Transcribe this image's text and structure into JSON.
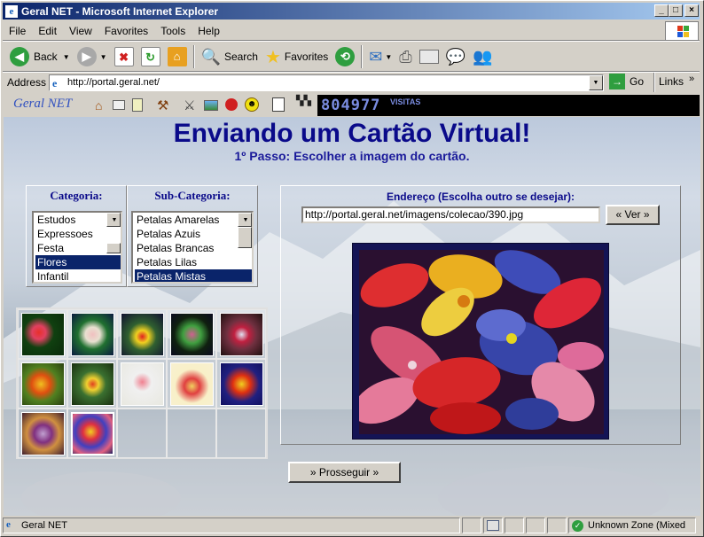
{
  "window": {
    "title": "Geral NET - Microsoft Internet Explorer"
  },
  "menu": [
    "File",
    "Edit",
    "View",
    "Favorites",
    "Tools",
    "Help"
  ],
  "toolbar": {
    "back": "Back",
    "search": "Search",
    "favorites": "Favorites"
  },
  "address": {
    "label": "Address",
    "url": "http://portal.geral.net/",
    "go": "Go",
    "links": "Links"
  },
  "linksbar": {
    "brand": "Geral NET",
    "counter": "804977",
    "counter_label": "VISITAS"
  },
  "page": {
    "title": "Enviando um Cartão Virtual!",
    "subtitle": "1º Passo: Escolher a imagem do cartão.",
    "categoria_label": "Categoria:",
    "subcategoria_label": "Sub-Categoria:",
    "categorias": [
      "Estudos",
      "Expressoes",
      "Festa",
      "Flores",
      "Infantil"
    ],
    "categoria_selected": 3,
    "subcategorias": [
      "Petalas Amarelas",
      "Petalas Azuis",
      "Petalas Brancas",
      "Petalas Lilas",
      "Petalas Mistas"
    ],
    "subcategoria_selected": 4,
    "endereco_label": "Endereço (Escolha outro se desejar):",
    "endereco_value": "http://portal.geral.net/imagens/colecao/390.jpg",
    "ver_button": "« Ver »",
    "prosseguir_button": "» Prosseguir »"
  },
  "status": {
    "text": "Geral NET",
    "zone": "Unknown Zone (Mixed"
  },
  "colors": {
    "title_blue": "#0a0a8a",
    "selection": "#0a246a",
    "titlebar": "#0a246a"
  }
}
